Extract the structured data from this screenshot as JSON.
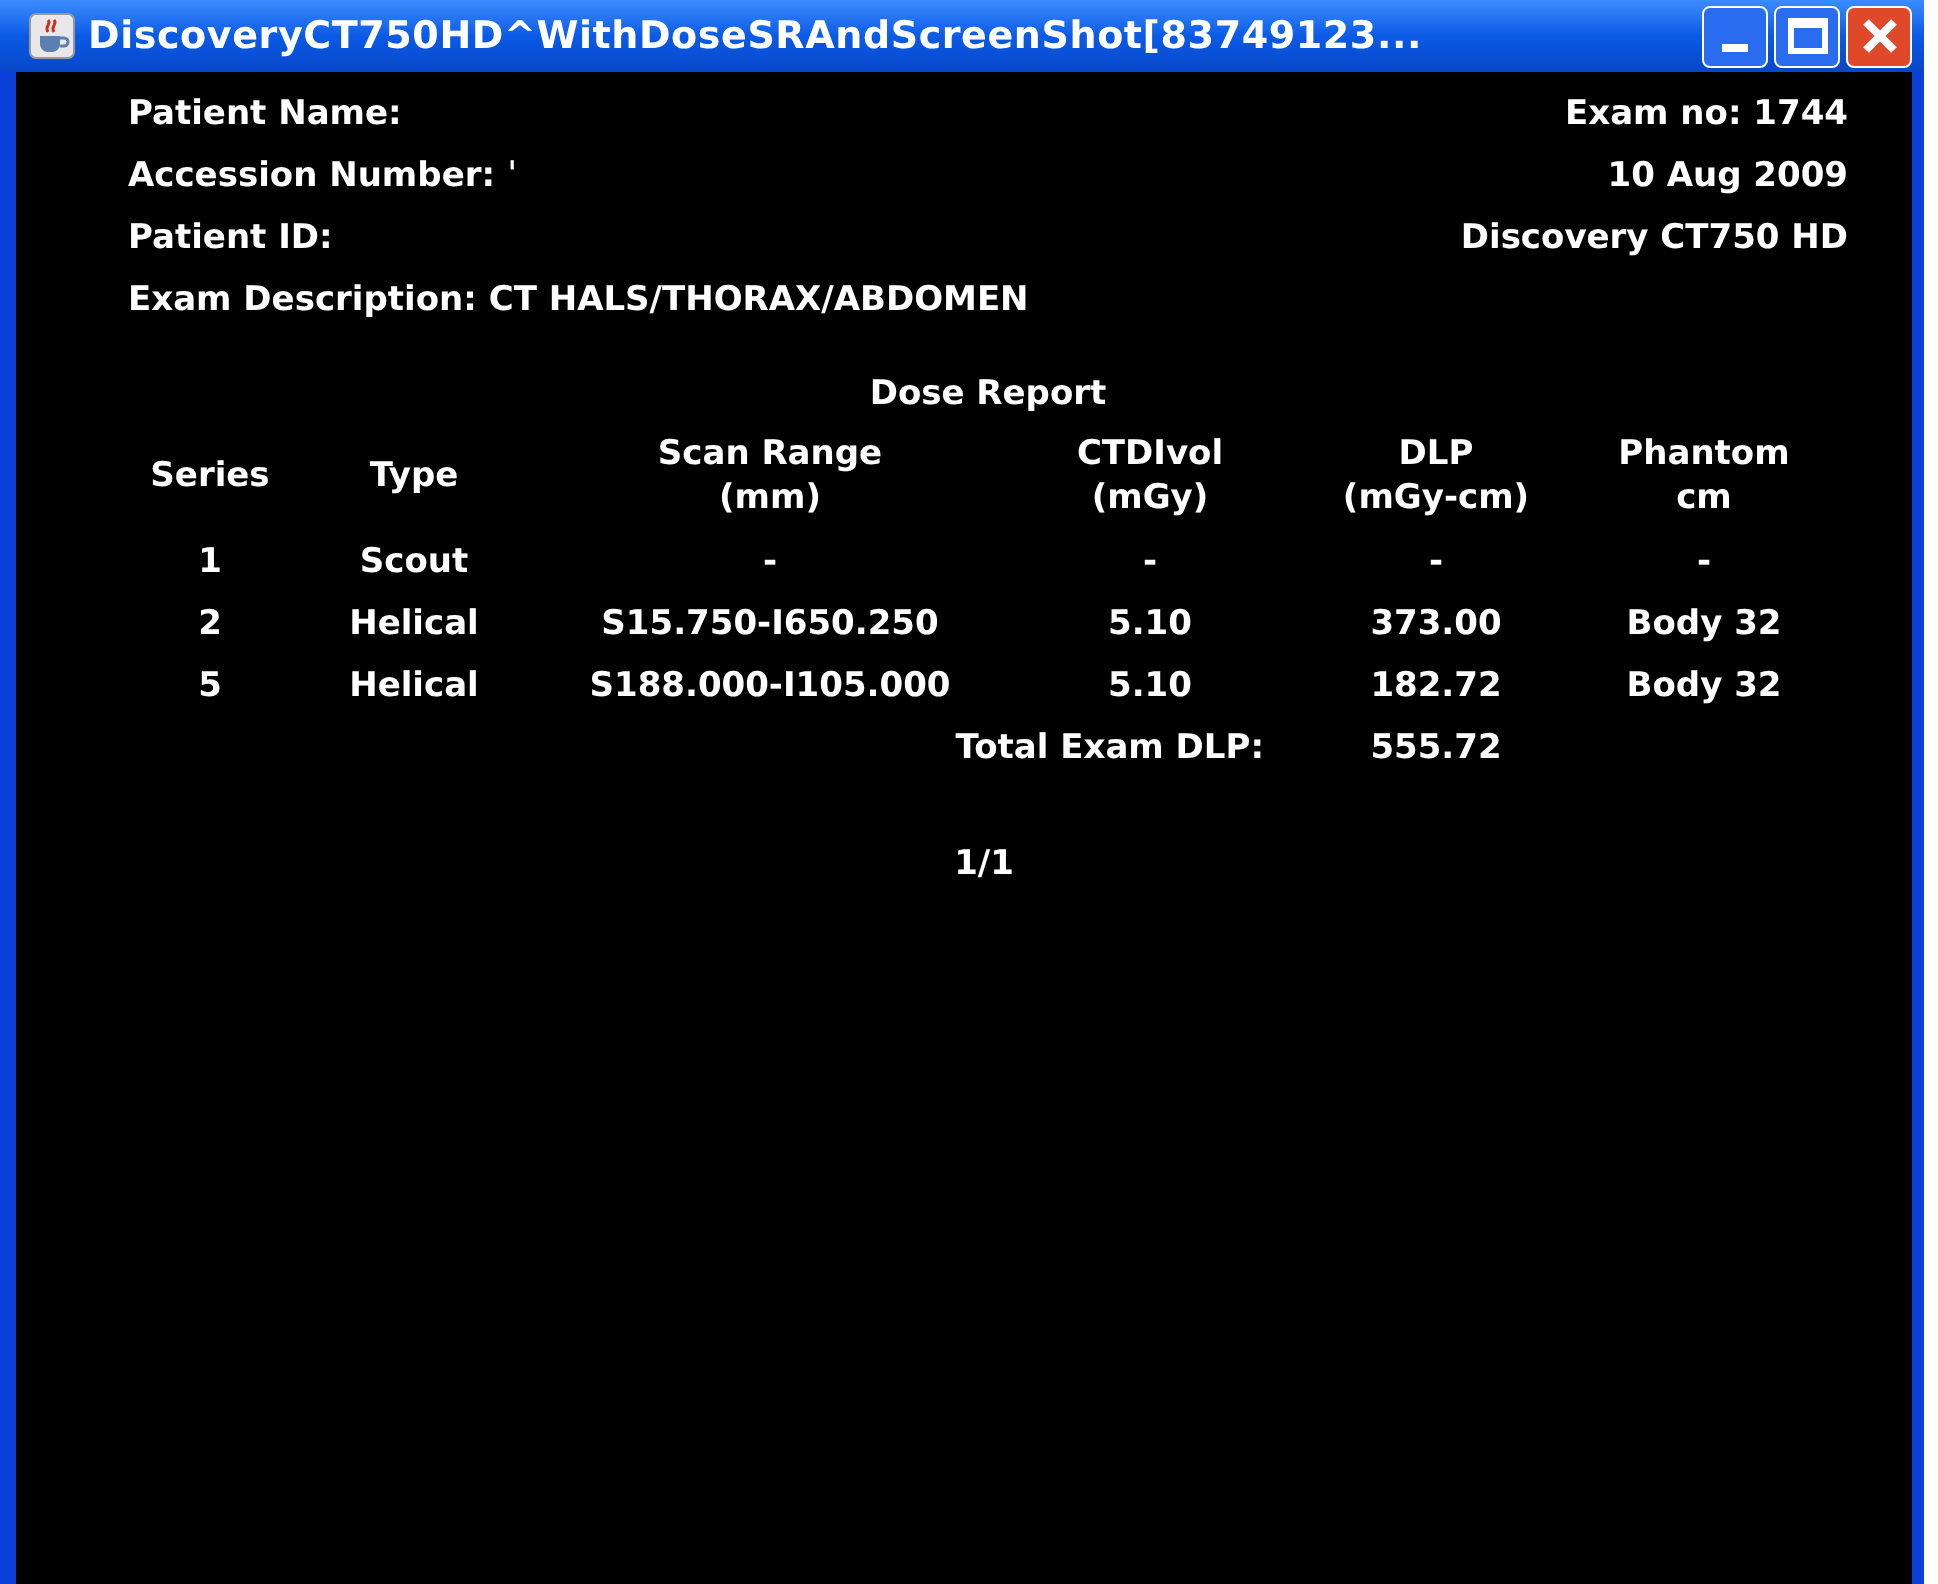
{
  "window": {
    "title": "DiscoveryCT750HD^WithDoseSRAndScreenShot[83749123..."
  },
  "header_left": [
    "Patient Name:",
    "Accession Number: ˈ",
    "Patient ID:",
    "Exam Description: CT HALS/THORAX/ABDOMEN"
  ],
  "header_right": [
    "Exam no: 1744",
    "10 Aug 2009",
    "Discovery CT750 HD"
  ],
  "report": {
    "title": "Dose Report",
    "columns": [
      "Series",
      "Type",
      "Scan Range\n(mm)",
      "CTDIvol\n(mGy)",
      "DLP\n(mGy-cm)",
      "Phantom\ncm"
    ],
    "rows": [
      [
        "1",
        "Scout",
        "-",
        "-",
        "-",
        "-"
      ],
      [
        "2",
        "Helical",
        "S15.750-I650.250",
        "5.10",
        "373.00",
        "Body 32"
      ],
      [
        "5",
        "Helical",
        "S188.000-I105.000",
        "5.10",
        "182.72",
        "Body 32"
      ]
    ],
    "total_label": "Total Exam DLP:",
    "total_value": "555.72"
  },
  "page": "1/1"
}
